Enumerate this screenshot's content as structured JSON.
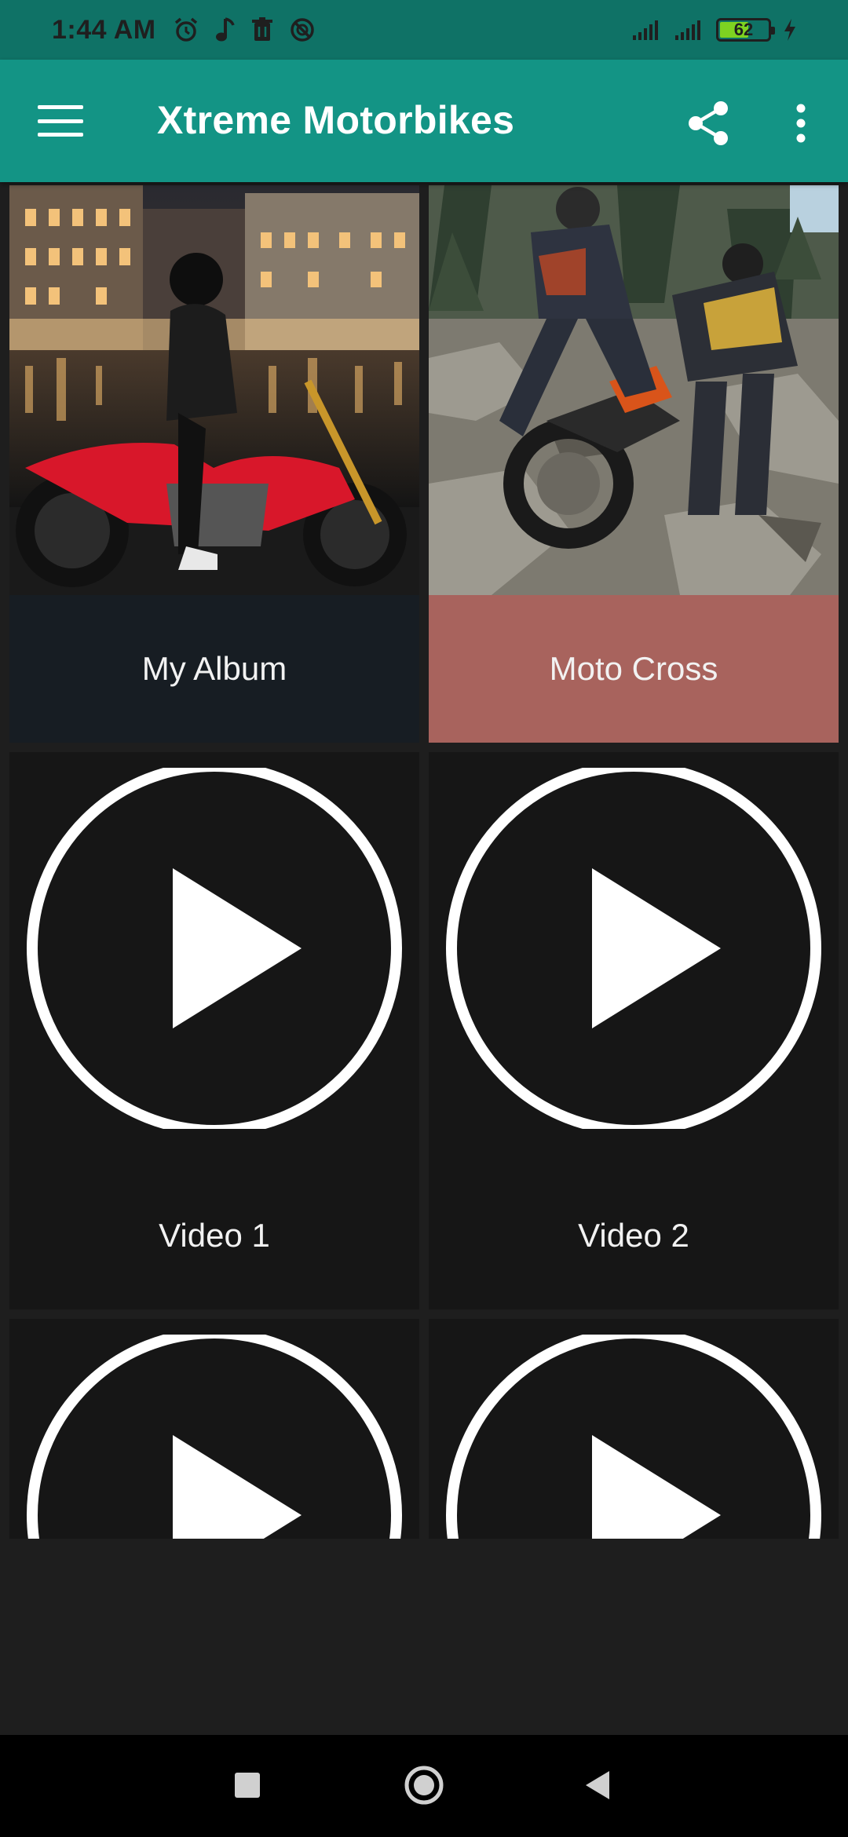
{
  "status_bar": {
    "time": "1:44 AM",
    "battery_level": "62",
    "battery_fraction": 0.62,
    "icons": [
      "alarm-icon",
      "music-note-icon",
      "trash-icon",
      "block-icon",
      "signal-icon",
      "signal-icon",
      "battery-icon",
      "charging-icon"
    ]
  },
  "app_bar": {
    "title": "Xtreme Motorbikes",
    "menu_icon": "hamburger-menu-icon",
    "share_icon": "share-icon",
    "overflow_icon": "more-vert-icon"
  },
  "grid": {
    "items": [
      {
        "label": "My Album",
        "kind": "album",
        "caption_color": "#171d23",
        "image": "woman in black leather with red sport motorcycle at night by water"
      },
      {
        "label": "Moto Cross",
        "kind": "album",
        "caption_color": "#a8635d",
        "image": "two riders pushing dirt bike up rocky forest slope"
      },
      {
        "label": "Video 1",
        "kind": "video"
      },
      {
        "label": "Video 2",
        "kind": "video"
      },
      {
        "label": "",
        "kind": "video"
      },
      {
        "label": "",
        "kind": "video"
      }
    ]
  },
  "nav_bar": {
    "recents": "recents-square-icon",
    "home": "home-circle-icon",
    "back": "back-triangle-icon"
  },
  "colors": {
    "status_bar": "#0f7266",
    "app_bar": "#139485",
    "background": "#1e1e1e",
    "video_tile": "#161616"
  }
}
